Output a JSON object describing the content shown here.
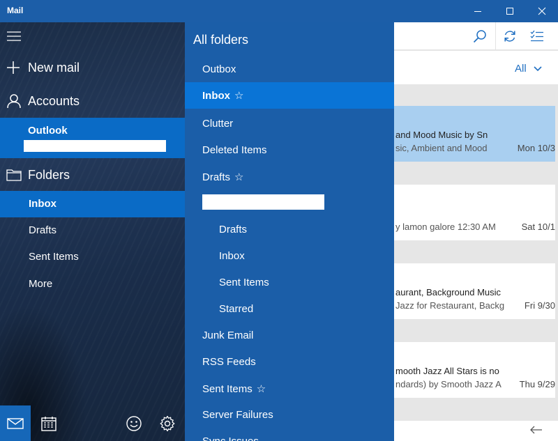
{
  "window": {
    "title": "Mail",
    "minimize_icon": "minimize-icon",
    "maximize_icon": "maximize-icon",
    "close_icon": "close-icon"
  },
  "nav": {
    "new_mail": "New mail",
    "accounts": "Accounts",
    "account": {
      "name": "Outlook",
      "email": ""
    },
    "folders_label": "Folders",
    "folders": [
      "Inbox",
      "Drafts",
      "Sent Items",
      "More"
    ],
    "active_folder": "Inbox",
    "bottom_icons": [
      "mail-icon",
      "calendar-icon",
      "smiley-icon",
      "gear-icon"
    ]
  },
  "flyout": {
    "title": "All folders",
    "items": [
      {
        "label": "Outbox",
        "level": 0,
        "favorite": false
      },
      {
        "label": "Inbox",
        "level": 0,
        "favorite": true,
        "active": true
      },
      {
        "label": "Clutter",
        "level": 0,
        "favorite": false
      },
      {
        "label": "Deleted Items",
        "level": 0,
        "favorite": false
      },
      {
        "label": "Drafts",
        "level": 0,
        "favorite": true
      },
      {
        "label": "",
        "level": 0,
        "redacted": true
      },
      {
        "label": "Drafts",
        "level": 1,
        "favorite": false
      },
      {
        "label": "Inbox",
        "level": 1,
        "favorite": false
      },
      {
        "label": "Sent Items",
        "level": 1,
        "favorite": false
      },
      {
        "label": "Starred",
        "level": 1,
        "favorite": false
      },
      {
        "label": "Junk Email",
        "level": 0,
        "favorite": false
      },
      {
        "label": "RSS Feeds",
        "level": 0,
        "favorite": false
      },
      {
        "label": "Sent Items",
        "level": 0,
        "favorite": true
      },
      {
        "label": "Server Failures",
        "level": 0,
        "favorite": false
      },
      {
        "label": "Sync Issues",
        "level": 0,
        "favorite": false
      }
    ],
    "star_glyph": "☆"
  },
  "messages": {
    "filter": "All",
    "list": [
      {
        "line1": "and Mood Music by Sn",
        "line2": "sic, Ambient and Mood",
        "date": "Mon 10/3",
        "selected": true
      },
      {
        "line1": "",
        "line2": "y lamon galore 12:30 AM",
        "date": "Sat 10/1",
        "selected": false
      },
      {
        "line1": "aurant, Background Music",
        "line2": "Jazz for Restaurant, Backg",
        "date": "Fri 9/30",
        "selected": false
      },
      {
        "line1": "mooth Jazz All Stars is no",
        "line2": "ndards) by Smooth Jazz A",
        "date": "Thu 9/29",
        "selected": false
      }
    ]
  },
  "colors": {
    "accent": "#0a6bc6",
    "flyout_bg": "#1b5ea8",
    "titlebar_bg": "#1c5ea8",
    "selected_message": "#a9cff0"
  }
}
